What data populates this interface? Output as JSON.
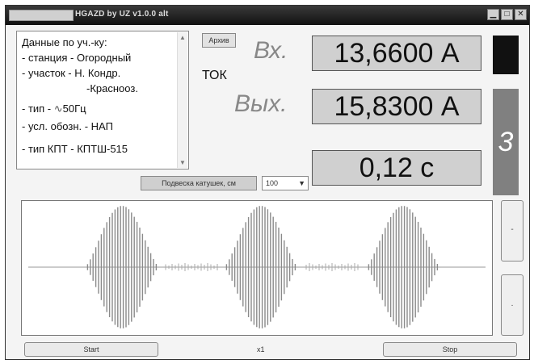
{
  "window": {
    "title": "HGAZD by UZ v1.0.0 alt"
  },
  "info": {
    "lines": [
      "Данные по уч.-ку:",
      " - станция - Огородный",
      " - участок - Н. Кондр.",
      "-Краснооз.",
      " - тип - ",
      "50Гц",
      " - усл. обозн. - НАП",
      " - тип КПТ - КПТШ-515"
    ]
  },
  "buttons": {
    "archive": "Архив",
    "coil": "Подвеска катушек, см",
    "start": "Start",
    "stop": "Stop",
    "side_top": "-",
    "side_bottom": "."
  },
  "labels": {
    "in": "Вх.",
    "out": "Вых.",
    "current": "ТОК"
  },
  "displays": {
    "in_value": "13,6600 А",
    "out_value": "15,8300 А",
    "time_value": "0,12  с"
  },
  "indicator_value": "3",
  "coil_select": "100",
  "zoom": "x1",
  "colors": {
    "indicator_dark": "#111111",
    "indicator_gray": "#808080",
    "display_bg": "#d0d0d0"
  }
}
